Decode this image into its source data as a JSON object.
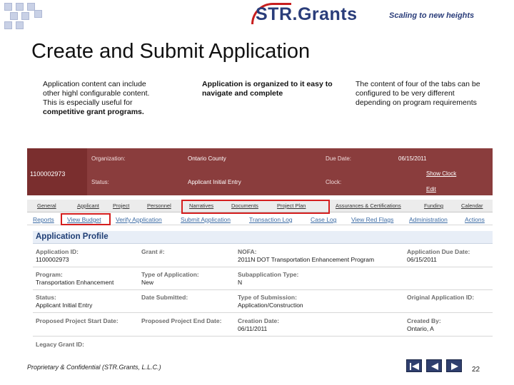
{
  "brand": {
    "name": "STR.Grants",
    "tagline": "Scaling to new heights"
  },
  "slide": {
    "title": "Create and Submit Application",
    "captions": [
      {
        "lines": [
          "Application content can include",
          "other highl configurable content.",
          "This is especially useful for",
          "competitive grant programs."
        ]
      },
      {
        "lines": [
          "Application is organized to it easy to",
          "navigate and complete"
        ]
      },
      {
        "lines": [
          "The content of four of the tabs can be",
          "configured to be very different",
          "depending on program requirements"
        ]
      }
    ],
    "footer": "Proprietary & Confidential (STR.Grants, L.L.C.)",
    "page_number": "22"
  },
  "app": {
    "header": {
      "id": "1100002973",
      "org_label": "Organization:",
      "org_value": "Ontario County",
      "status_label": "Status:",
      "status_value": "Applicant Initial Entry",
      "due_label": "Due Date:",
      "due_value": "06/15/2011",
      "clock_label": "Clock:",
      "show_clock": "Show Clock",
      "edit": "Edit"
    },
    "tabs_primary": [
      "General",
      "Applicant",
      "Project",
      "Personnel",
      "Narratives",
      "Documents",
      "Project Plan",
      "Assurances & Certifications",
      "Funding",
      "Calendar"
    ],
    "tabs_secondary": [
      "Reports",
      "View Budget",
      "Verify Application",
      "Submit Application",
      "Transaction Log",
      "Case Log",
      "View Red Flags",
      "Administration",
      "Actions"
    ],
    "profile_title": "Application Profile",
    "fields": [
      {
        "label": "Application ID:",
        "value": "1100002973"
      },
      {
        "label": "Grant #:",
        "value": ""
      },
      {
        "label": "NOFA:",
        "value": "2011N     DOT Transportation Enhancement Program"
      },
      {
        "label": "Application Due Date:",
        "value": "06/15/2011"
      },
      {
        "label": "Program:",
        "value": "Transportation Enhancement"
      },
      {
        "label": "Type of Application:",
        "value": "New"
      },
      {
        "label": "Subapplication Type:",
        "value": "N"
      },
      {
        "label": "",
        "value": ""
      },
      {
        "label": "Status:",
        "value": "Applicant Initial Entry"
      },
      {
        "label": "Date Submitted:",
        "value": ""
      },
      {
        "label": "Type of Submission:",
        "value": "Application/Construction"
      },
      {
        "label": "Original Application ID:",
        "value": ""
      },
      {
        "label": "Proposed Project Start Date:",
        "value": ""
      },
      {
        "label": "Proposed Project End Date:",
        "value": ""
      },
      {
        "label": "Creation Date:",
        "value": "06/11/2011"
      },
      {
        "label": "Created By:",
        "value": "Ontario, A"
      },
      {
        "label": "Legacy Grant ID:",
        "value": ""
      }
    ]
  },
  "colors": {
    "header_bg": "#8a3d3d",
    "highlight": "#d51f1f",
    "link": "#3b6aa3",
    "brand": "#2a3d7a"
  },
  "icons": [
    "first-slide-icon",
    "previous-slide-icon",
    "next-slide-icon",
    "last-slide-icon"
  ]
}
